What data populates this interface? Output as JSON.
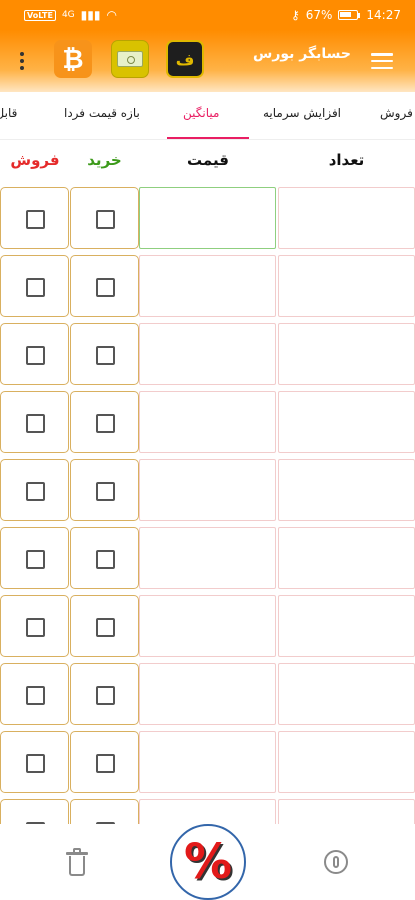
{
  "statusbar": {
    "badge": "VoLTE",
    "signal": "4G",
    "battery": "67%",
    "time": "14:27",
    "battery_fill": 0.67
  },
  "appbar": {
    "title": "حسابگر بورس",
    "logos": [
      "bitcoin-app-icon",
      "money-app-icon",
      "market-app-icon"
    ]
  },
  "tabs": [
    {
      "label": "فروش"
    },
    {
      "label": "افزایش سرمایه"
    },
    {
      "label": "میانگین",
      "active": true
    },
    {
      "label": "بازه قیمت فردا"
    },
    {
      "label": "قابل خ"
    }
  ],
  "columns": {
    "count": "تعداد",
    "price": "قیمت",
    "buy": "خرید",
    "sell": "فروش"
  },
  "colors": {
    "accent": "#ff8c00",
    "active_tab": "#e91e63",
    "buy": "#3c9a1a",
    "sell": "#e52a2a"
  },
  "rows": 10,
  "fab": {
    "label": "%"
  }
}
